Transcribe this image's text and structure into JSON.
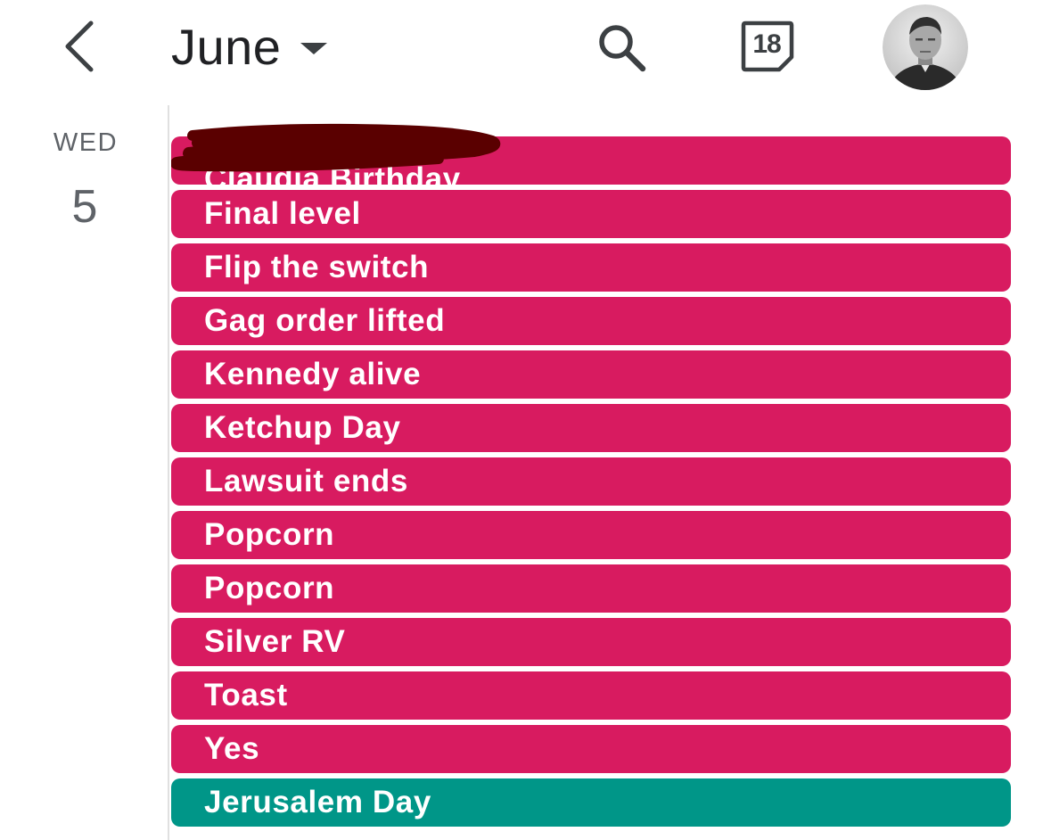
{
  "header": {
    "month": "June",
    "today_day": "18"
  },
  "day": {
    "name": "WED",
    "number": "5"
  },
  "colors": {
    "event_pink": "#d81b60",
    "event_teal": "#009688",
    "redaction": "#5a0000"
  },
  "icons": {
    "back": "chevron-left-icon",
    "dropdown": "caret-down-icon",
    "search": "search-icon",
    "today": "calendar-today-icon"
  },
  "events": [
    {
      "label": "Claudia Birthday",
      "color": "#d81b60",
      "redacted": true
    },
    {
      "label": "Final level",
      "color": "#d81b60"
    },
    {
      "label": "Flip the switch",
      "color": "#d81b60"
    },
    {
      "label": "Gag order lifted",
      "color": "#d81b60"
    },
    {
      "label": "Kennedy alive",
      "color": "#d81b60"
    },
    {
      "label": "Ketchup Day",
      "color": "#d81b60"
    },
    {
      "label": "Lawsuit ends",
      "color": "#d81b60"
    },
    {
      "label": "Popcorn",
      "color": "#d81b60"
    },
    {
      "label": "Popcorn",
      "color": "#d81b60"
    },
    {
      "label": "Silver RV",
      "color": "#d81b60"
    },
    {
      "label": "Toast",
      "color": "#d81b60"
    },
    {
      "label": "Yes",
      "color": "#d81b60"
    },
    {
      "label": "Jerusalem Day",
      "color": "#009688"
    }
  ]
}
